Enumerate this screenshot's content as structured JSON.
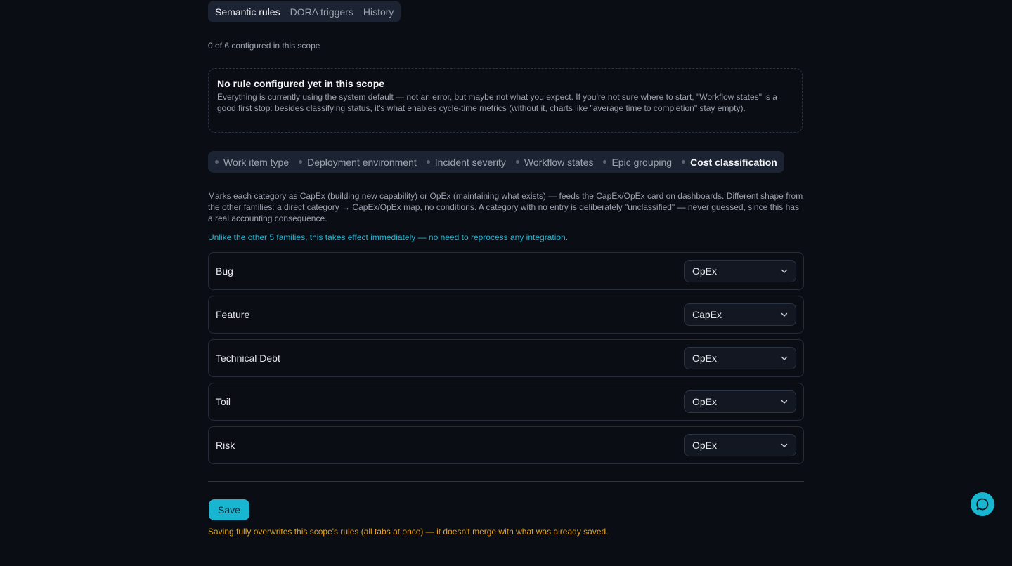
{
  "top_tabs": [
    {
      "label": "Semantic rules",
      "active": true
    },
    {
      "label": "DORA triggers",
      "active": false
    },
    {
      "label": "History",
      "active": false
    }
  ],
  "count_text": "0 of 6 configured in this scope",
  "notice": {
    "title": "No rule configured yet in this scope",
    "text": "Everything is currently using the system default — not an error, but maybe not what you expect. If you're not sure where to start, \"Workflow states\" is a good first stop: besides classifying status, it's what enables cycle-time metrics (without it, charts like \"average time to completion\" stay empty)."
  },
  "family_tabs": [
    {
      "label": "Work item type",
      "active": false
    },
    {
      "label": "Deployment environment",
      "active": false
    },
    {
      "label": "Incident severity",
      "active": false
    },
    {
      "label": "Workflow states",
      "active": false
    },
    {
      "label": "Epic grouping",
      "active": false
    },
    {
      "label": "Cost classification",
      "active": true
    }
  ],
  "description": "Marks each category as CapEx (building new capability) or OpEx (maintaining what exists) — feeds the CapEx/OpEx card on dashboards. Different shape from the other families: a direct category → CapEx/OpEx map, no conditions. A category with no entry is deliberately \"unclassified\" — never guessed, since this has a real accounting consequence.",
  "note": "Unlike the other 5 families, this takes effect immediately — no need to reprocess any integration.",
  "rows": [
    {
      "label": "Bug",
      "value": "OpEx"
    },
    {
      "label": "Feature",
      "value": "CapEx"
    },
    {
      "label": "Technical Debt",
      "value": "OpEx"
    },
    {
      "label": "Toil",
      "value": "OpEx"
    },
    {
      "label": "Risk",
      "value": "OpEx"
    }
  ],
  "save_label": "Save",
  "warning": "Saving fully overwrites this scope's rules (all tabs at once) — it doesn't merge with what was already saved.",
  "colors": {
    "accent": "#19b6d1",
    "warning": "#e8a317",
    "note": "#22b8d6"
  },
  "icons": {
    "select": "chevron-down-icon",
    "chat": "chat-bubble-icon"
  }
}
